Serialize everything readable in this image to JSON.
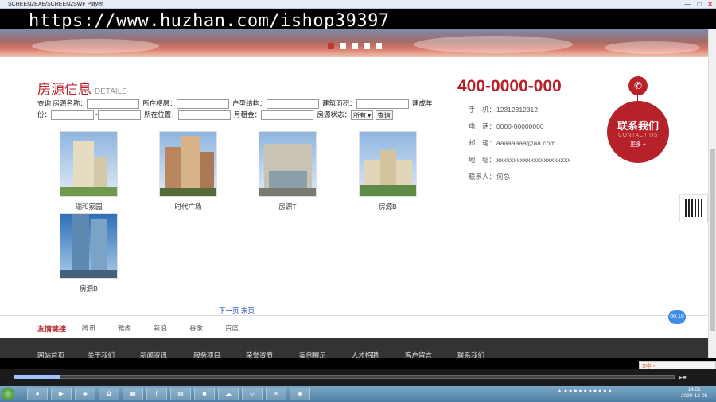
{
  "window": {
    "title": "SCREEN2EXE/SCREEN2SWF Player"
  },
  "watermark": "https://www.huzhan.com/ishop39397",
  "banner": {
    "dots": [
      true,
      false,
      false,
      false,
      false
    ]
  },
  "listing": {
    "title": "房源信息",
    "subtitle": "DETAILS",
    "form": {
      "query_label": "查询",
      "name_label": "房源名称：",
      "floor_label": "所在楼层：",
      "layout_label": "户型结构：",
      "area_label": "建筑面积：",
      "year_label": "建成年份：",
      "location_label": "所在位置：",
      "rent_label": "月租金：",
      "status_label": "房源状态：",
      "status_value": "所有",
      "search_button": "查询"
    },
    "properties": [
      {
        "name": "瑞和家园"
      },
      {
        "name": "时代广场"
      },
      {
        "name": "房源T"
      },
      {
        "name": "房源B"
      },
      {
        "name": "房源B"
      }
    ],
    "pager": {
      "next": "下一页",
      "last": "末页"
    }
  },
  "contact": {
    "hotline": "400-0000-000",
    "rows": [
      {
        "label": "手　机：",
        "value": "12312312312"
      },
      {
        "label": "电　话：",
        "value": "0000-00000000"
      },
      {
        "label": "邮　箱：",
        "value": "aaaaaaaa@aa.com"
      },
      {
        "label": "地　址：",
        "value": "xxxxxxxxxxxxxxxxxxxxxx"
      },
      {
        "label": "联系人：",
        "value": "何总"
      }
    ],
    "badge_title": "联系我们",
    "badge_sub": "CONTACT US",
    "badge_more": "更多 +"
  },
  "friend_links": {
    "title": "友情链接",
    "items": [
      "腾讯",
      "雅虎",
      "新浪",
      "谷歌",
      "百度"
    ]
  },
  "timer": "00:16",
  "footer_nav": [
    "网站首页",
    "关于我们",
    "新闻资讯",
    "服务项目",
    "荣誉资质",
    "案例展示",
    "人才招聘",
    "客户留言",
    "联系我们"
  ],
  "ime": "S中·◦",
  "player": {
    "progress": 0.07
  },
  "taskbar": {
    "clock_time": "14:01",
    "clock_date": "2020-12-05"
  }
}
